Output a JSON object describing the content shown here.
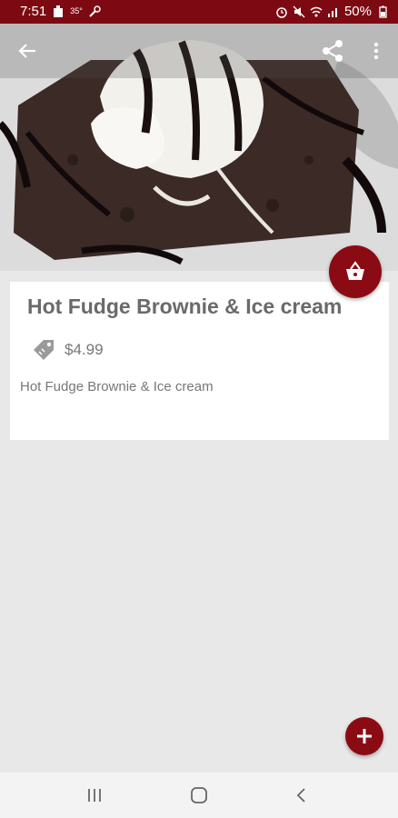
{
  "status": {
    "time": "7:51",
    "temp": "35°",
    "battery": "50%"
  },
  "product": {
    "title": "Hot Fudge Brownie & Ice cream",
    "price": "$4.99",
    "description": "Hot Fudge Brownie & Ice cream"
  },
  "colors": {
    "brand": "#8b0b14",
    "status_bar": "#7d0a12"
  },
  "icons": {
    "back": "arrow-left-icon",
    "share": "share-icon",
    "more": "more-vert-icon",
    "cart": "basket-icon",
    "add": "plus-icon",
    "price_tag": "tag-icon"
  }
}
